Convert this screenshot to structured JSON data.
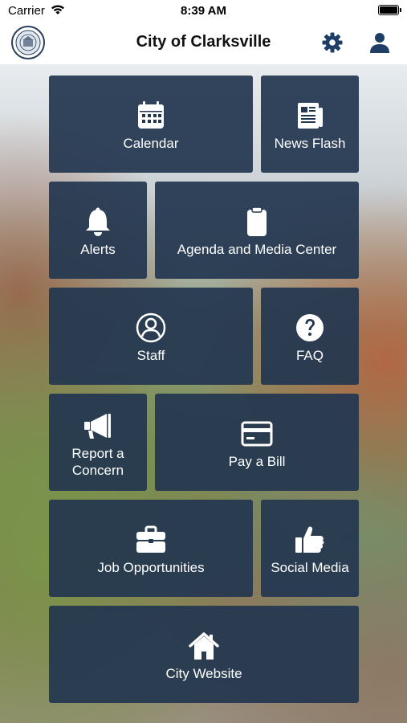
{
  "status_bar": {
    "carrier": "Carrier",
    "time": "8:39 AM"
  },
  "navbar": {
    "title": "City of Clarksville"
  },
  "tiles": [
    {
      "label": "Calendar",
      "icon": "calendar-icon"
    },
    {
      "label": "News Flash",
      "icon": "newspaper-icon"
    },
    {
      "label": "Alerts",
      "icon": "bell-icon"
    },
    {
      "label": "Agenda and Media Center",
      "icon": "clipboard-icon"
    },
    {
      "label": "Staff",
      "icon": "user-circle-icon"
    },
    {
      "label": "FAQ",
      "icon": "question-icon"
    },
    {
      "label": "Report a Concern",
      "icon": "megaphone-icon"
    },
    {
      "label": "Pay a Bill",
      "icon": "credit-card-icon"
    },
    {
      "label": "Job Opportunities",
      "icon": "briefcase-icon"
    },
    {
      "label": "Social Media",
      "icon": "thumbs-up-icon"
    },
    {
      "label": "City Website",
      "icon": "home-icon"
    }
  ],
  "colors": {
    "tile_bg": "#243750",
    "gear": "#1f3e66",
    "text_on_tile": "#ffffff"
  }
}
